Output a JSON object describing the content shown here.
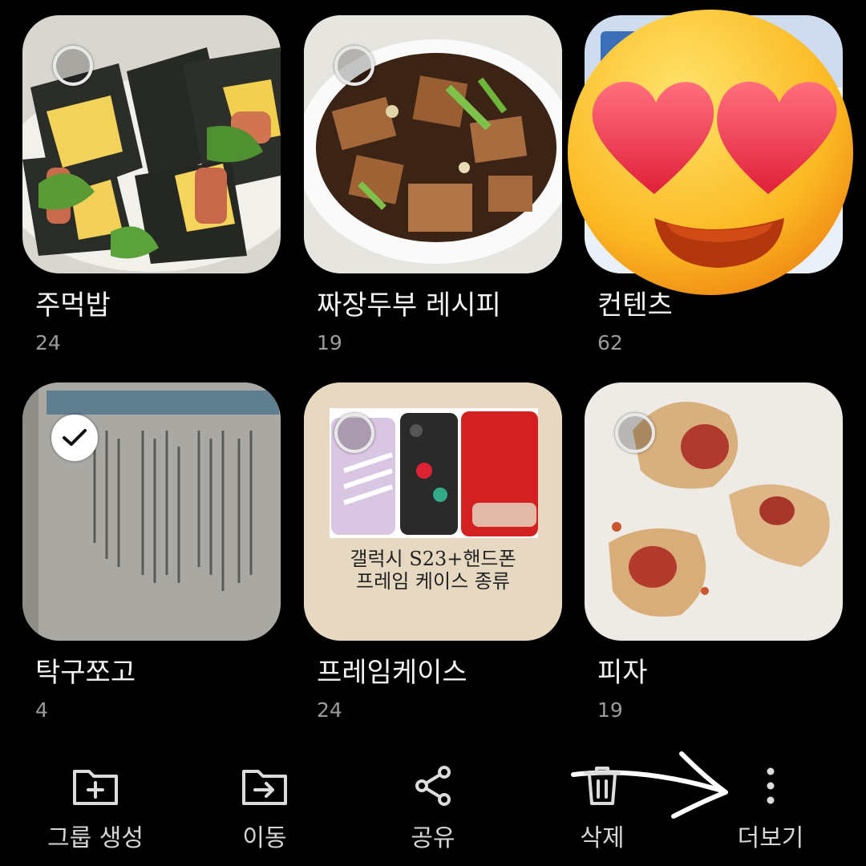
{
  "albums": [
    {
      "title": "주먹밥",
      "count": "24",
      "selected": false
    },
    {
      "title": "짜장두부 레시피",
      "count": "19",
      "selected": false
    },
    {
      "title": "컨텐츠",
      "count": "62",
      "selected": false
    },
    {
      "title": "탁구쪼고",
      "count": "4",
      "selected": true
    },
    {
      "title": "프레임케이스",
      "count": "24",
      "selected": false
    },
    {
      "title": "피자",
      "count": "19",
      "selected": false
    }
  ],
  "case_thumbnail": {
    "line1": "갤럭시 S23+핸드폰",
    "line2": "프레임 케이스 종류"
  },
  "actions": {
    "create_group": "그룹 생성",
    "move": "이동",
    "share": "공유",
    "delete": "삭제",
    "more": "더보기"
  },
  "icons": {
    "create_group": "folder-plus-icon",
    "move": "folder-move-icon",
    "share": "share-icon",
    "delete": "trash-icon",
    "more": "more-vertical-icon"
  },
  "colors": {
    "background": "#000000",
    "title_text": "#f2f2f2",
    "count_text": "#9b9b9b",
    "action_text": "#d6d6d6"
  },
  "overlays": {
    "sticker": "heart-eyes-emoji",
    "annotation": "hand-drawn-arrow"
  }
}
